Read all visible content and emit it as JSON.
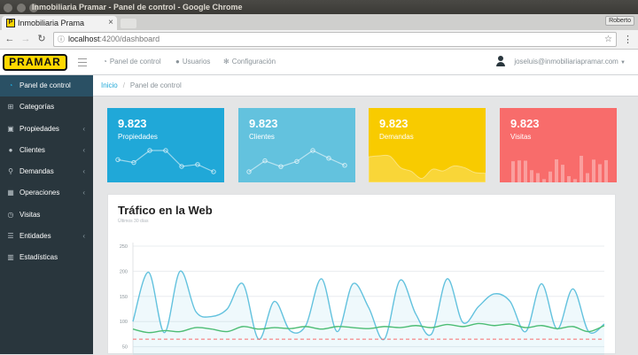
{
  "window": {
    "title": "Inmobiliaria Pramar - Panel de control - Google Chrome",
    "profile": "Roberto"
  },
  "browser": {
    "tab_title": "Inmobiliaria Prama",
    "url_host": "localhost",
    "url_path": ":4200/dashboard"
  },
  "header": {
    "logo_text": "PRAMAR",
    "nav": [
      {
        "label": "Panel de control",
        "icon": "speedometer-icon"
      },
      {
        "label": "Usuarios",
        "icon": "user-icon"
      },
      {
        "label": "Configuración",
        "icon": "gear-icon"
      }
    ],
    "user_email": "joseluis@inmobiliariapramar.com"
  },
  "sidebar": {
    "items": [
      {
        "label": "Panel de control",
        "icon": "speedometer-icon",
        "active": true,
        "chevron": false
      },
      {
        "label": "Categorías",
        "icon": "sitemap-icon",
        "active": false,
        "chevron": false
      },
      {
        "label": "Propiedades",
        "icon": "briefcase-icon",
        "active": false,
        "chevron": true
      },
      {
        "label": "Clientes",
        "icon": "users-icon",
        "active": false,
        "chevron": true
      },
      {
        "label": "Demandas",
        "icon": "search-icon",
        "active": false,
        "chevron": true
      },
      {
        "label": "Operaciones",
        "icon": "calculator-icon",
        "active": false,
        "chevron": true
      },
      {
        "label": "Visitas",
        "icon": "clock-icon",
        "active": false,
        "chevron": false
      },
      {
        "label": "Entidades",
        "icon": "list-icon",
        "active": false,
        "chevron": true
      },
      {
        "label": "Estadísticas",
        "icon": "bar-chart-icon",
        "active": false,
        "chevron": false
      }
    ]
  },
  "breadcrumb": {
    "home": "Inicio",
    "current": "Panel de control"
  },
  "cards": [
    {
      "value": "9.823",
      "label": "Propiedades",
      "color": "#20a8d8",
      "spark": "line"
    },
    {
      "value": "9.823",
      "label": "Clientes",
      "color": "#63c2de",
      "spark": "line"
    },
    {
      "value": "9.823",
      "label": "Demandas",
      "color": "#f8cb00",
      "spark": "area"
    },
    {
      "value": "9.823",
      "label": "Visitas",
      "color": "#f86c6b",
      "spark": "bar"
    }
  ],
  "traffic": {
    "title": "Tráfico en la Web",
    "subtitle": "Últimos 30 días"
  },
  "chart_data": {
    "type": "line",
    "ylim": [
      0,
      250
    ],
    "y_ticks": [
      "250",
      "200",
      "150",
      "100",
      "50"
    ],
    "grid": true,
    "series": [
      {
        "color": "#63c2de",
        "values": [
          100,
          198,
          78,
          200,
          120,
          110,
          125,
          175,
          65,
          140,
          82,
          92,
          185,
          80,
          175,
          128,
          65,
          182,
          115,
          75,
          185,
          98,
          130,
          155,
          140,
          80,
          175,
          85,
          165,
          80,
          95
        ]
      },
      {
        "color": "#4dbd74",
        "values": [
          85,
          78,
          82,
          80,
          88,
          85,
          80,
          90,
          85,
          88,
          86,
          90,
          85,
          90,
          88,
          86,
          90,
          88,
          92,
          88,
          94,
          90,
          96,
          92,
          95,
          88,
          92,
          86,
          90,
          80,
          92
        ]
      },
      {
        "color": "#f86c6b",
        "dashed": true,
        "values": [
          65,
          65,
          65,
          65,
          65,
          65,
          65,
          65,
          65,
          65,
          65,
          65,
          65,
          65,
          65,
          65,
          65,
          65,
          65,
          65,
          65,
          65,
          65,
          65,
          65,
          65,
          65,
          65,
          65,
          65,
          65
        ]
      }
    ]
  },
  "sparklines": {
    "propiedades": [
      65,
      59,
      84,
      84,
      51,
      55,
      40
    ],
    "clientes": [
      1,
      18,
      9,
      17,
      34,
      22,
      11
    ],
    "demandas": [
      78,
      81,
      80,
      45,
      34,
      12,
      40,
      35,
      50,
      45,
      30,
      28
    ],
    "visitas": [
      78,
      81,
      80,
      45,
      34,
      12,
      40,
      85,
      65,
      23,
      12,
      98,
      34,
      84,
      67,
      82
    ]
  }
}
